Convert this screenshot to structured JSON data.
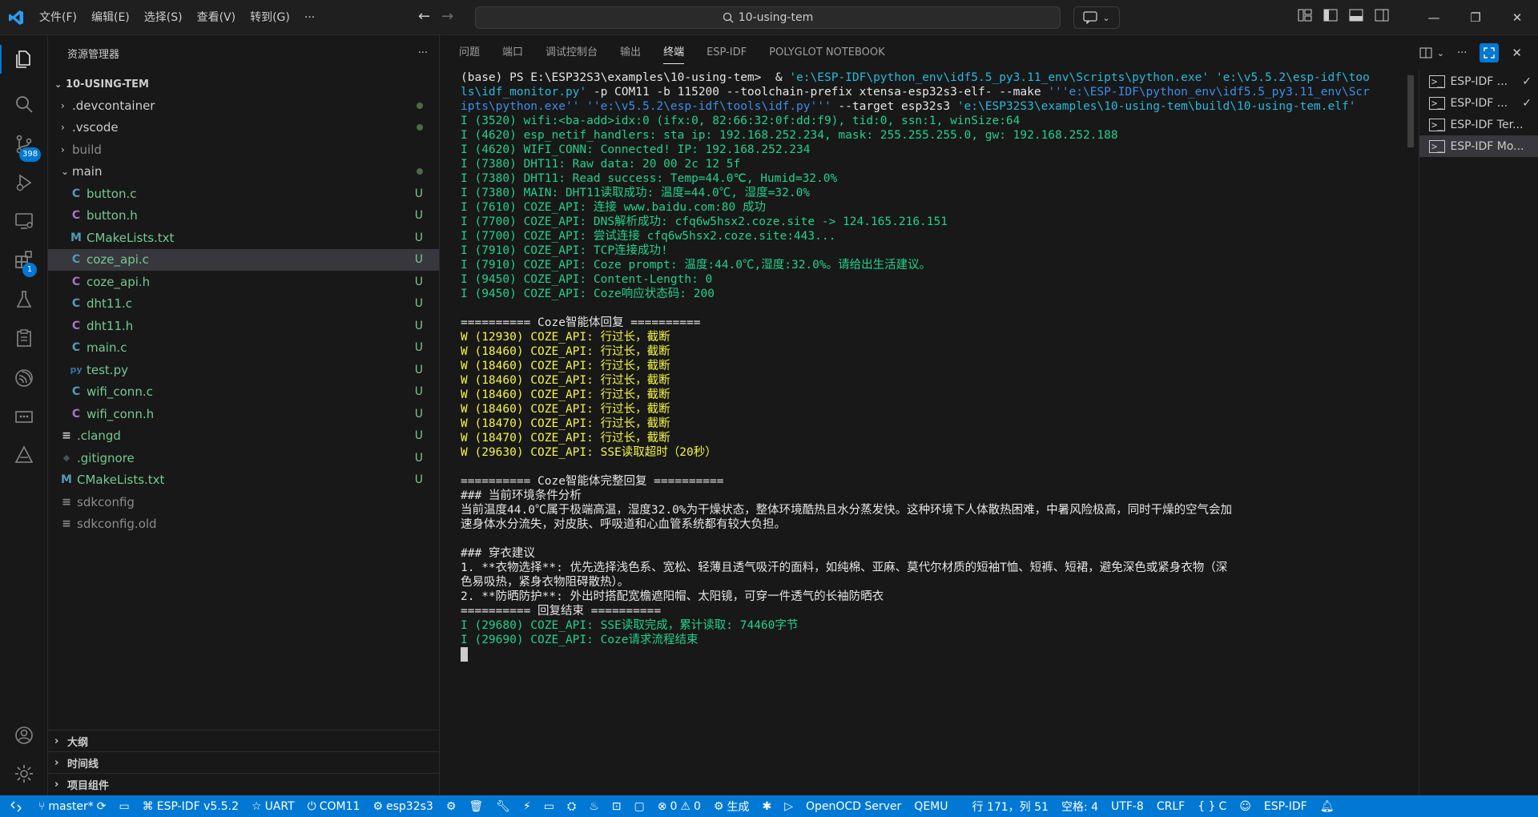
{
  "titlebar": {
    "menus": [
      "文件(F)",
      "编辑(E)",
      "选择(S)",
      "查看(V)",
      "转到(G)",
      "···"
    ],
    "search_text": "10-using-tem"
  },
  "activity": {
    "scm_badge": "398",
    "extensions_badge": "1"
  },
  "sidebar": {
    "title": "资源管理器",
    "more": "···",
    "root": "10-USING-TEM",
    "items": [
      {
        "label": ".devcontainer",
        "status": ""
      },
      {
        "label": ".vscode",
        "status": ""
      },
      {
        "label": "build",
        "status": ""
      },
      {
        "label": "main",
        "status": ""
      },
      {
        "label": "button.c",
        "icon": "C",
        "status": "U"
      },
      {
        "label": "button.h",
        "icon": "C",
        "status": "U"
      },
      {
        "label": "CMakeLists.txt",
        "icon": "M",
        "status": "U"
      },
      {
        "label": "coze_api.c",
        "icon": "C",
        "status": "U"
      },
      {
        "label": "coze_api.h",
        "icon": "C",
        "status": "U"
      },
      {
        "label": "dht11.c",
        "icon": "C",
        "status": "U"
      },
      {
        "label": "dht11.h",
        "icon": "C",
        "status": "U"
      },
      {
        "label": "main.c",
        "icon": "C",
        "status": "U"
      },
      {
        "label": "test.py",
        "icon": "py",
        "status": "U"
      },
      {
        "label": "wifi_conn.c",
        "icon": "C",
        "status": "U"
      },
      {
        "label": "wifi_conn.h",
        "icon": "C",
        "status": "U"
      },
      {
        "label": ".clangd",
        "icon": "≡",
        "status": "U"
      },
      {
        "label": ".gitignore",
        "icon": "◆",
        "status": "U"
      },
      {
        "label": "CMakeLists.txt",
        "icon": "M",
        "status": "U"
      },
      {
        "label": "sdkconfig",
        "icon": "≡",
        "status": ""
      },
      {
        "label": "sdkconfig.old",
        "icon": "≡",
        "status": ""
      }
    ],
    "outline": "大纲",
    "timeline": "时间线",
    "project_components": "项目组件"
  },
  "panel": {
    "tabs": [
      "问题",
      "端口",
      "调试控制台",
      "输出",
      "终端",
      "ESP-IDF",
      "POLYGLOT NOTEBOOK"
    ],
    "active_tab": "终端",
    "terminals": [
      "ESP-IDF ...",
      "ESP-IDF ...",
      "ESP-IDF Ter...",
      "ESP-IDF Mo..."
    ]
  },
  "terminal": {
    "cmd_1": "(base) PS E:\\ESP32S3\\examples\\10-using-tem>  & ",
    "cmd_2": "'e:\\ESP-IDF\\python_env\\idf5.5_py3.11_env\\Scripts\\python.exe'",
    "cmd_3": " 'e:\\v5.5.2\\esp-idf\\too",
    "cmd_4": "ls\\idf_monitor.py'",
    "cmd_5": " -p COM11 -b 115200 --toolchain-prefix xtensa-esp32s3-elf- --make ",
    "cmd_6": "'''e:\\ESP-IDF\\python_env\\idf5.5_py3.11_env\\Scr",
    "cmd_7": "ipts\\python.exe'' ''e:\\v5.5.2\\esp-idf\\tools\\idf.py'''",
    "cmd_8": " --target esp32s3 ",
    "cmd_9": "'e:\\ESP32S3\\examples\\10-using-tem\\build\\10-using-tem.elf'",
    "log_lines": [
      "I (3520) wifi:<ba-add>idx:0 (ifx:0, 82:66:32:0f:dd:f9), tid:0, ssn:1, winSize:64",
      "I (4620) esp_netif_handlers: sta ip: 192.168.252.234, mask: 255.255.255.0, gw: 192.168.252.188",
      "I (4620) WIFI_CONN: Connected! IP: 192.168.252.234",
      "I (7380) DHT11: Raw data: 20 00 2c 12 5f",
      "I (7380) DHT11: Read success: Temp=44.0℃, Humid=32.0%",
      "I (7380) MAIN: DHT11读取成功: 温度=44.0℃, 湿度=32.0%",
      "I (7610) COZE_API: 连接 www.baidu.com:80 成功",
      "I (7700) COZE_API: DNS解析成功: cfq6w5hsx2.coze.site -> 124.165.216.151",
      "I (7700) COZE_API: 尝试连接 cfq6w5hsx2.coze.site:443...",
      "I (7910) COZE_API: TCP连接成功!",
      "I (7910) COZE_API: Coze prompt: 温度:44.0℃,湿度:32.0%。请给出生活建议。",
      "I (9450) COZE_API: Content-Length: 0",
      "I (9450) COZE_API: Coze响应状态码: 200"
    ],
    "reply_header": "========== Coze智能体回复 ==========",
    "warn_lines": [
      "W (12930) COZE_API: 行过长，截断",
      "W (18460) COZE_API: 行过长，截断",
      "W (18460) COZE_API: 行过长，截断",
      "W (18460) COZE_API: 行过长，截断",
      "W (18460) COZE_API: 行过长，截断",
      "W (18460) COZE_API: 行过长，截断",
      "W (18470) COZE_API: 行过长，截断",
      "W (18470) COZE_API: 行过长，截断",
      "W (29630) COZE_API: SSE读取超时（20秒）"
    ],
    "full_header": "========== Coze智能体完整回复 ==========",
    "body_lines": [
      "### 当前环境条件分析",
      "当前温度44.0℃属于极端高温，湿度32.0%为干燥状态，整体环境酷热且水分蒸发快。这种环境下人体散热困难，中暑风险极高，同时干燥的空气会加",
      "速身体水分流失，对皮肤、呼吸道和心血管系统都有较大负担。",
      "",
      "### 穿衣建议",
      "1. **衣物选择**: 优先选择浅色系、宽松、轻薄且透气吸汗的面料，如纯棉、亚麻、莫代尔材质的短袖T恤、短裤、短裙，避免深色或紧身衣物（深",
      "色易吸热，紧身衣物阻碍散热）。",
      "2. **防晒防护**: 外出时搭配宽檐遮阳帽、太阳镜，可穿一件透气的长袖防晒衣",
      "========== 回复结束 =========="
    ],
    "end_lines": [
      "I (29680) COZE_API: SSE读取完成，累计读取: 74460字节",
      "I (29690) COZE_API: Coze请求流程结束"
    ]
  },
  "statusbar": {
    "branch": "master*",
    "idf_version": "ESP-IDF v5.5.2",
    "uart": "UART",
    "com": "COM11",
    "target": "esp32s3",
    "errors": "0",
    "warnings": "0",
    "build": "生成",
    "openocd": "OpenOCD Server",
    "qemu": "QEMU",
    "position": "行 171，列 51",
    "spaces": "空格: 4",
    "encoding": "UTF-8",
    "eol": "CRLF",
    "language": "C",
    "espidf": "ESP-IDF"
  }
}
